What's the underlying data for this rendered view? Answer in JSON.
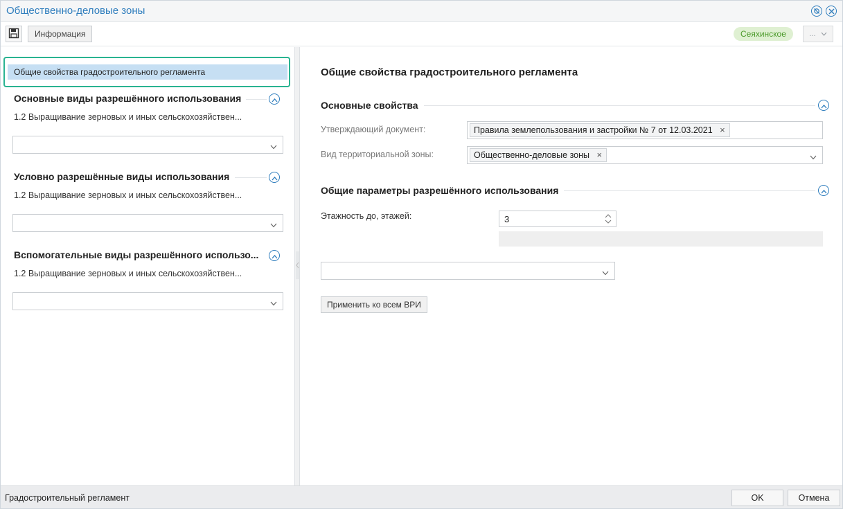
{
  "window": {
    "title": "Общественно-деловые зоны",
    "icons": {
      "help": "no-fingerprint-icon",
      "close": "close-icon"
    }
  },
  "toolbar": {
    "save_icon": "floppy-disk-icon",
    "info_label": "Информация",
    "region_badge": "Сеяхинское",
    "more_label": "...",
    "colors": {
      "badge_bg": "#dff0d2",
      "badge_text": "#4b9a2a"
    }
  },
  "left": {
    "selected_item": "Общие свойства градостроительного регламента",
    "sections": [
      {
        "title": "Основные виды разрешённого использования",
        "item": "1.2 Выращивание зерновых и иных сельскохозяйствен...",
        "select_value": ""
      },
      {
        "title": "Условно разрешённые виды использования",
        "item": "1.2 Выращивание зерновых и иных сельскохозяйствен...",
        "select_value": ""
      },
      {
        "title": "Вспомогательные виды разрешённого использо...",
        "item": "1.2 Выращивание зерновых и иных сельскохозяйствен...",
        "select_value": ""
      }
    ]
  },
  "right": {
    "title": "Общие свойства градостроительного регламента",
    "basic": {
      "title": "Основные свойства",
      "doc_label": "Утверждающий документ:",
      "doc_value": "Правила землепользования и застройки № 7 от 12.03.2021",
      "zone_label": "Вид территориальной зоны:",
      "zone_value": "Общественно-деловые зоны"
    },
    "params": {
      "title": "Общие параметры разрешённого использования",
      "floors_label": "Этажность до, этажей:",
      "floors_value": "3",
      "select_value": "",
      "apply_label": "Применить ко всем ВРИ"
    }
  },
  "status": {
    "text": "Градостроительный регламент",
    "ok_label": "OK",
    "cancel_label": "Отмена"
  },
  "colors": {
    "accent": "#2e7dbd",
    "selection": "#c6dff3",
    "focus_border": "#29b391"
  }
}
